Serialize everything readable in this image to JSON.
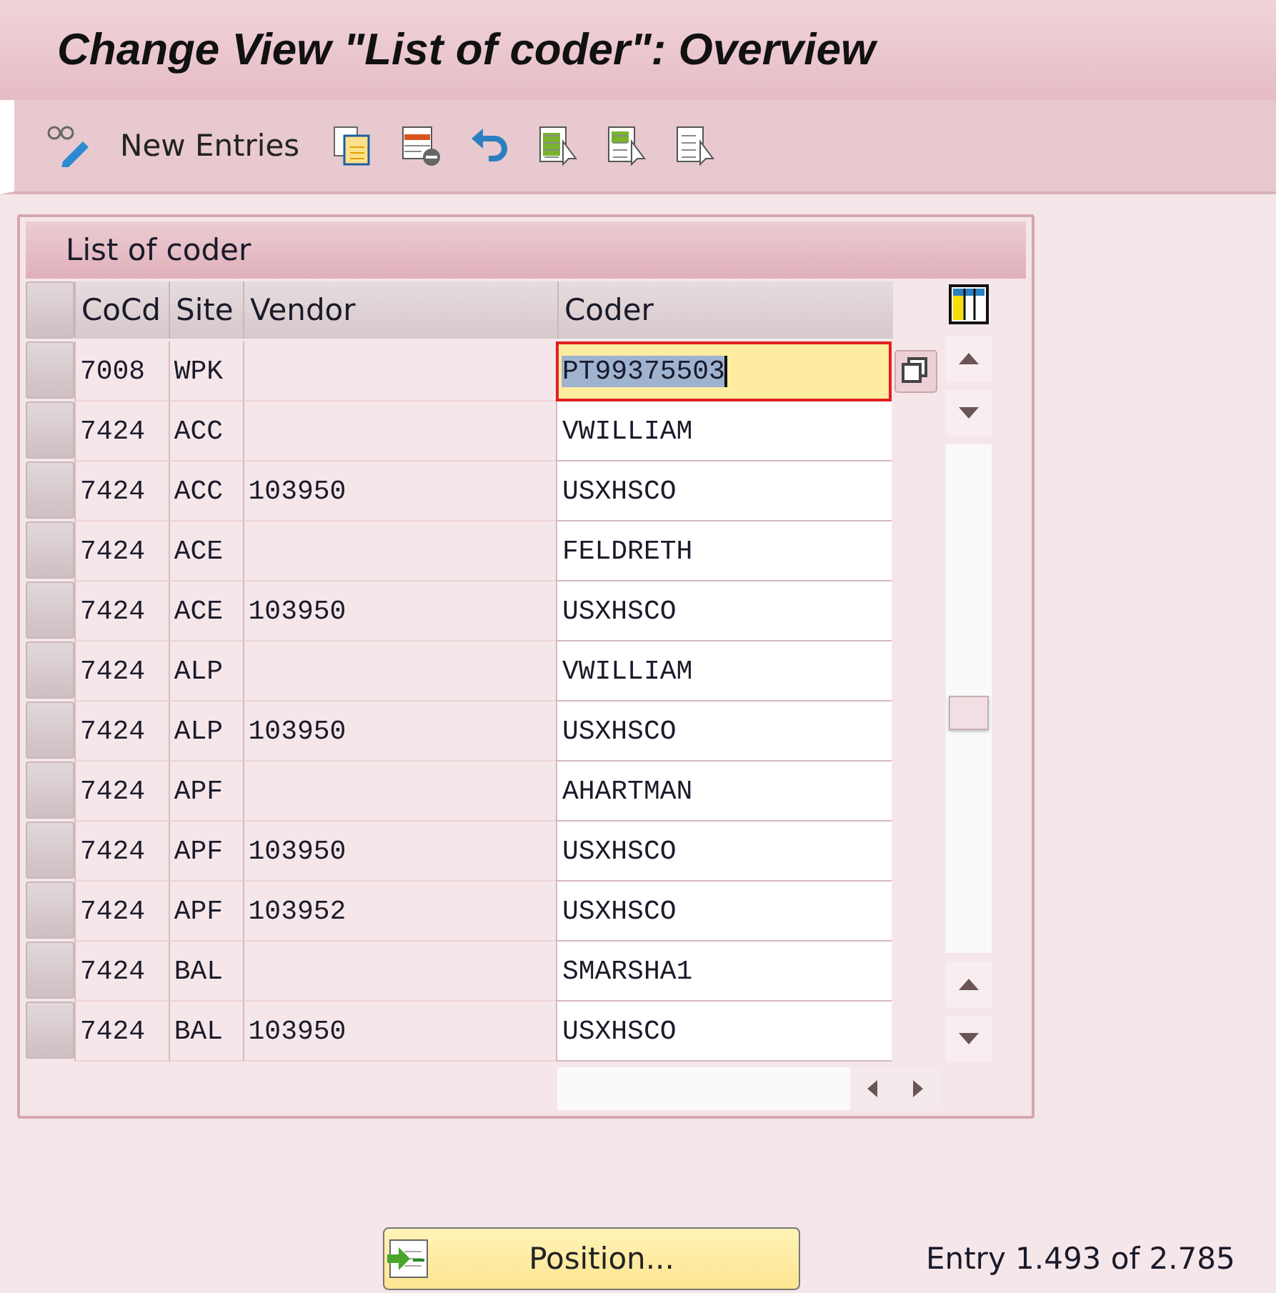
{
  "window": {
    "title": "Change View \"List of coder\": Overview"
  },
  "toolbar": {
    "new_entries": "New Entries"
  },
  "table": {
    "title": "List of coder",
    "columns": [
      "CoCd",
      "Site",
      "Vendor",
      "Coder"
    ],
    "rows": [
      {
        "cocd": "7008",
        "site": "WPK",
        "vendor": "",
        "coder": "PT99375503",
        "focused": true
      },
      {
        "cocd": "7424",
        "site": "ACC",
        "vendor": "",
        "coder": "VWILLIAM",
        "focused": false
      },
      {
        "cocd": "7424",
        "site": "ACC",
        "vendor": "103950",
        "coder": "USXHSCO",
        "focused": false
      },
      {
        "cocd": "7424",
        "site": "ACE",
        "vendor": "",
        "coder": "FELDRETH",
        "focused": false
      },
      {
        "cocd": "7424",
        "site": "ACE",
        "vendor": "103950",
        "coder": "USXHSCO",
        "focused": false
      },
      {
        "cocd": "7424",
        "site": "ALP",
        "vendor": "",
        "coder": "VWILLIAM",
        "focused": false
      },
      {
        "cocd": "7424",
        "site": "ALP",
        "vendor": "103950",
        "coder": "USXHSCO",
        "focused": false
      },
      {
        "cocd": "7424",
        "site": "APF",
        "vendor": "",
        "coder": "AHARTMAN",
        "focused": false
      },
      {
        "cocd": "7424",
        "site": "APF",
        "vendor": "103950",
        "coder": "USXHSCO",
        "focused": false
      },
      {
        "cocd": "7424",
        "site": "APF",
        "vendor": "103952",
        "coder": "USXHSCO",
        "focused": false
      },
      {
        "cocd": "7424",
        "site": "BAL",
        "vendor": "",
        "coder": "SMARSHA1",
        "focused": false
      },
      {
        "cocd": "7424",
        "site": "BAL",
        "vendor": "103950",
        "coder": "USXHSCO",
        "focused": false
      }
    ]
  },
  "position_button": "Position...",
  "entry_info": "Entry 1.493 of 2.785"
}
